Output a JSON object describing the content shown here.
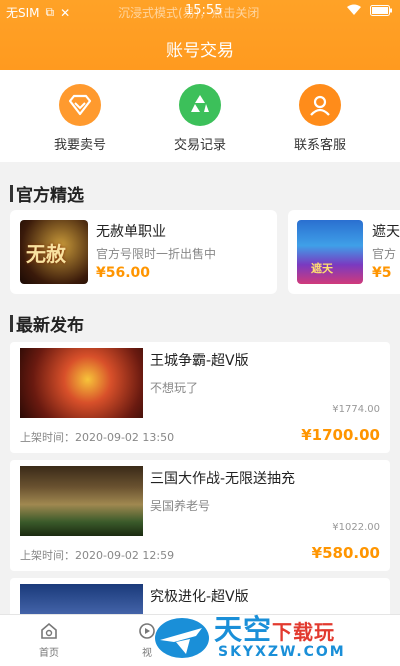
{
  "status_bar": {
    "carrier": "无SIM",
    "mode_text": "沉浸式模式(易)",
    "mode_hint": "，点击关闭",
    "time": "15:55"
  },
  "header": {
    "title": "账号交易"
  },
  "quick_actions": [
    {
      "label": "我要卖号",
      "icon": "diamond-icon",
      "color": "#ff9a2e"
    },
    {
      "label": "交易记录",
      "icon": "recycle-icon",
      "color": "#3cc05a"
    },
    {
      "label": "联系客服",
      "icon": "user-service-icon",
      "color": "#ff8c1a"
    }
  ],
  "official": {
    "title": "官方精选",
    "items": [
      {
        "name": "无赦单职业",
        "desc": "官方号限时一折出售中",
        "price": "¥56.00",
        "thumb_text": "无赦"
      },
      {
        "name": "遮天",
        "desc": "官方",
        "price": "¥5",
        "thumb_text": "遮天"
      }
    ]
  },
  "latest": {
    "title": "最新发布",
    "items": [
      {
        "name": "王城争霸-超V版",
        "desc": "不想玩了",
        "orig_price": "¥1774.00",
        "time": "上架时间：2020-09-02 13:50",
        "price": "¥1700.00"
      },
      {
        "name": "三国大作战-无限送抽充",
        "desc": "吴国养老号",
        "orig_price": "¥1022.00",
        "time": "上架时间：2020-09-02 12:59",
        "price": "¥580.00"
      },
      {
        "name": "究极进化-超V版",
        "desc": "",
        "orig_price": "",
        "time": "",
        "price": ""
      }
    ]
  },
  "tabbar": {
    "home": "首页",
    "video": "视"
  },
  "watermark": {
    "brand": "天空",
    "suffix": "下载玩",
    "url": "SKYXZW.COM"
  }
}
